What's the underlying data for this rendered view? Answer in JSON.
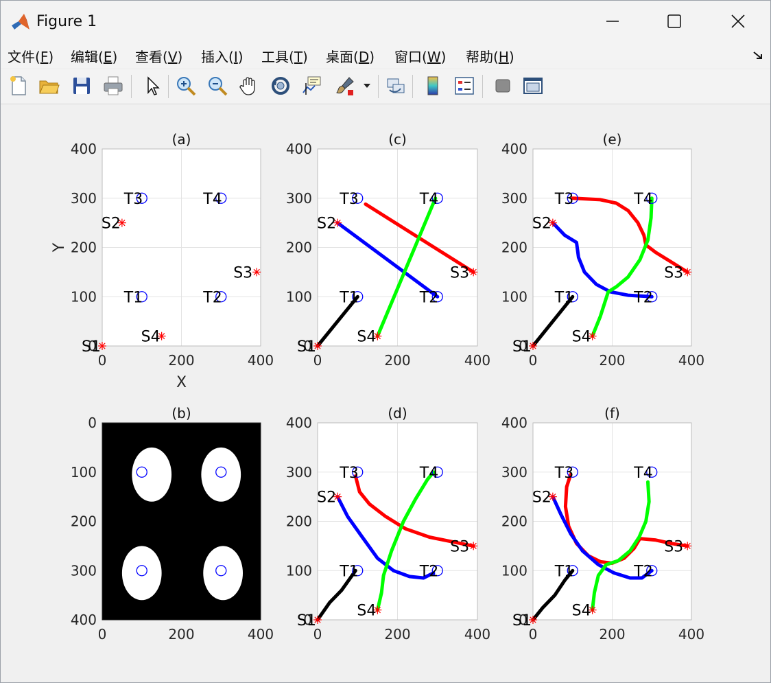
{
  "window": {
    "title": "Figure 1",
    "controls": {
      "minimize": "minimize-icon",
      "maximize": "maximize-icon",
      "close": "close-icon"
    }
  },
  "menu": [
    {
      "label": "文件(",
      "key": "F",
      "end": ")"
    },
    {
      "label": "编辑(",
      "key": "E",
      "end": ")"
    },
    {
      "label": "查看(",
      "key": "V",
      "end": ")"
    },
    {
      "label": "插入(",
      "key": "I",
      "end": ")"
    },
    {
      "label": "工具(",
      "key": "T",
      "end": ")"
    },
    {
      "label": "桌面(",
      "key": "D",
      "end": ")"
    },
    {
      "label": "窗口(",
      "key": "W",
      "end": ")"
    },
    {
      "label": "帮助(",
      "key": "H",
      "end": ")"
    }
  ],
  "toolbar": [
    "new-figure-icon",
    "open-folder-icon",
    "save-icon",
    "print-icon",
    "pointer-icon",
    "zoom-in-icon",
    "zoom-out-icon",
    "pan-icon",
    "rotate-3d-icon",
    "data-cursor-icon",
    "brush-icon",
    "brush-dropdown-icon",
    "link-plot-icon",
    "colorbar-icon",
    "legend-icon",
    "hide-tools-icon",
    "dock-icon"
  ],
  "colors": {
    "red": "#ff0000",
    "blue": "#0000ff",
    "green": "#00ff00",
    "black": "#000000",
    "start_marker": "#ff0000",
    "target_marker": "#0000ff"
  },
  "chart_data": [
    {
      "title": "(a)",
      "type": "scatter",
      "xlabel": "X",
      "ylabel": "Y",
      "xlim": [
        0,
        400
      ],
      "ylim": [
        0,
        400
      ],
      "y_direction": "normal",
      "grid": true,
      "xticks": [
        "0",
        "200",
        "400"
      ],
      "yticks": [
        "400",
        "300",
        "200",
        "100",
        "0"
      ],
      "starts": [
        {
          "label": "S1",
          "x": 0,
          "y": 0
        },
        {
          "label": "S2",
          "x": 50,
          "y": 250
        },
        {
          "label": "S3",
          "x": 390,
          "y": 150
        },
        {
          "label": "S4",
          "x": 150,
          "y": 20
        }
      ],
      "targets": [
        {
          "label": "T1",
          "x": 100,
          "y": 100
        },
        {
          "label": "T2",
          "x": 300,
          "y": 100
        },
        {
          "label": "T3",
          "x": 100,
          "y": 300
        },
        {
          "label": "T4",
          "x": 300,
          "y": 300
        }
      ],
      "paths": []
    },
    {
      "title": "(b)",
      "type": "heatmap",
      "xlabel": "",
      "ylabel": "",
      "xlim": [
        0,
        400
      ],
      "ylim": [
        0,
        400
      ],
      "y_direction": "reverse",
      "grid": false,
      "xticks": [
        "0",
        "200",
        "400"
      ],
      "yticks": [
        "0",
        "100",
        "200",
        "300",
        "400"
      ],
      "ellipses": [
        {
          "cx": 125,
          "cy": 105,
          "rx": 50,
          "ry": 55
        },
        {
          "cx": 300,
          "cy": 105,
          "rx": 50,
          "ry": 55
        },
        {
          "cx": 100,
          "cy": 305,
          "rx": 50,
          "ry": 55
        },
        {
          "cx": 305,
          "cy": 305,
          "rx": 50,
          "ry": 55
        }
      ],
      "targets": [
        {
          "x": 100,
          "y": 100
        },
        {
          "x": 300,
          "y": 100
        },
        {
          "x": 100,
          "y": 300
        },
        {
          "x": 300,
          "y": 300
        }
      ]
    },
    {
      "title": "(c)",
      "type": "line",
      "xlabel": "",
      "ylabel": "",
      "xlim": [
        0,
        400
      ],
      "ylim": [
        0,
        400
      ],
      "y_direction": "normal",
      "grid": true,
      "xticks": [
        "0",
        "200",
        "400"
      ],
      "yticks": [
        "400",
        "300",
        "200",
        "100",
        "0"
      ],
      "starts": [
        {
          "label": "S1",
          "x": 0,
          "y": 0
        },
        {
          "label": "S2",
          "x": 50,
          "y": 250
        },
        {
          "label": "S3",
          "x": 390,
          "y": 150
        },
        {
          "label": "S4",
          "x": 150,
          "y": 20
        }
      ],
      "targets": [
        {
          "label": "T1",
          "x": 100,
          "y": 100
        },
        {
          "label": "T2",
          "x": 300,
          "y": 100
        },
        {
          "label": "T3",
          "x": 100,
          "y": 300
        },
        {
          "label": "T4",
          "x": 300,
          "y": 300
        }
      ],
      "paths": [
        {
          "color": "#ff0000",
          "points": [
            [
              120,
              288
            ],
            [
              390,
              150
            ]
          ]
        },
        {
          "color": "#0000ff",
          "points": [
            [
              50,
              250
            ],
            [
              300,
              100
            ]
          ]
        },
        {
          "color": "#00ff00",
          "points": [
            [
              150,
              20
            ],
            [
              295,
              300
            ]
          ]
        },
        {
          "color": "#000000",
          "points": [
            [
              0,
              0
            ],
            [
              100,
              100
            ]
          ]
        }
      ]
    },
    {
      "title": "(d)",
      "type": "line",
      "xlabel": "",
      "ylabel": "",
      "xlim": [
        0,
        400
      ],
      "ylim": [
        0,
        400
      ],
      "y_direction": "normal",
      "grid": true,
      "xticks": [
        "0",
        "200",
        "400"
      ],
      "yticks": [
        "400",
        "300",
        "200",
        "100",
        "0"
      ],
      "starts": [
        {
          "label": "S1",
          "x": 0,
          "y": 0
        },
        {
          "label": "S2",
          "x": 50,
          "y": 250
        },
        {
          "label": "S3",
          "x": 390,
          "y": 150
        },
        {
          "label": "S4",
          "x": 150,
          "y": 20
        }
      ],
      "targets": [
        {
          "label": "T1",
          "x": 100,
          "y": 100
        },
        {
          "label": "T2",
          "x": 300,
          "y": 100
        },
        {
          "label": "T3",
          "x": 100,
          "y": 300
        },
        {
          "label": "T4",
          "x": 300,
          "y": 300
        }
      ],
      "paths": [
        {
          "color": "#ff0000",
          "points": [
            [
              95,
              292
            ],
            [
              105,
              260
            ],
            [
              130,
              235
            ],
            [
              170,
              210
            ],
            [
              220,
              185
            ],
            [
              280,
              168
            ],
            [
              340,
              158
            ],
            [
              390,
              150
            ]
          ]
        },
        {
          "color": "#0000ff",
          "points": [
            [
              50,
              250
            ],
            [
              75,
              210
            ],
            [
              110,
              170
            ],
            [
              150,
              125
            ],
            [
              190,
              100
            ],
            [
              230,
              88
            ],
            [
              265,
              85
            ],
            [
              290,
              95
            ]
          ]
        },
        {
          "color": "#00ff00",
          "points": [
            [
              150,
              20
            ],
            [
              160,
              55
            ],
            [
              165,
              90
            ],
            [
              185,
              140
            ],
            [
              215,
              200
            ],
            [
              245,
              245
            ],
            [
              275,
              285
            ],
            [
              290,
              300
            ]
          ]
        },
        {
          "color": "#000000",
          "points": [
            [
              0,
              0
            ],
            [
              30,
              35
            ],
            [
              60,
              60
            ],
            [
              95,
              100
            ]
          ]
        }
      ]
    },
    {
      "title": "(e)",
      "type": "line",
      "xlabel": "",
      "ylabel": "",
      "xlim": [
        0,
        400
      ],
      "ylim": [
        0,
        400
      ],
      "y_direction": "normal",
      "grid": true,
      "xticks": [
        "0",
        "200",
        "400"
      ],
      "yticks": [
        "400",
        "300",
        "200",
        "100",
        "0"
      ],
      "starts": [
        {
          "label": "S1",
          "x": 0,
          "y": 0
        },
        {
          "label": "S2",
          "x": 50,
          "y": 250
        },
        {
          "label": "S3",
          "x": 390,
          "y": 150
        },
        {
          "label": "S4",
          "x": 150,
          "y": 20
        }
      ],
      "targets": [
        {
          "label": "T1",
          "x": 100,
          "y": 100
        },
        {
          "label": "T2",
          "x": 300,
          "y": 100
        },
        {
          "label": "T3",
          "x": 100,
          "y": 300
        },
        {
          "label": "T4",
          "x": 300,
          "y": 300
        }
      ],
      "paths": [
        {
          "color": "#ff0000",
          "points": [
            [
              100,
              300
            ],
            [
              170,
              297
            ],
            [
              210,
              290
            ],
            [
              240,
              275
            ],
            [
              265,
              250
            ],
            [
              280,
              225
            ],
            [
              285,
              205
            ],
            [
              310,
              190
            ],
            [
              350,
              170
            ],
            [
              390,
              150
            ]
          ]
        },
        {
          "color": "#0000ff",
          "points": [
            [
              50,
              250
            ],
            [
              80,
              225
            ],
            [
              110,
              210
            ],
            [
              115,
              180
            ],
            [
              130,
              150
            ],
            [
              160,
              125
            ],
            [
              195,
              110
            ],
            [
              240,
              103
            ],
            [
              300,
              100
            ]
          ]
        },
        {
          "color": "#00ff00",
          "points": [
            [
              150,
              20
            ],
            [
              170,
              60
            ],
            [
              190,
              110
            ],
            [
              210,
              120
            ],
            [
              240,
              140
            ],
            [
              270,
              175
            ],
            [
              290,
              215
            ],
            [
              298,
              260
            ],
            [
              300,
              300
            ]
          ]
        },
        {
          "color": "#000000",
          "points": [
            [
              0,
              0
            ],
            [
              100,
              100
            ]
          ]
        }
      ]
    },
    {
      "title": "(f)",
      "type": "line",
      "xlabel": "",
      "ylabel": "",
      "xlim": [
        0,
        400
      ],
      "ylim": [
        0,
        400
      ],
      "y_direction": "normal",
      "grid": true,
      "xticks": [
        "0",
        "200",
        "400"
      ],
      "yticks": [
        "400",
        "300",
        "200",
        "100",
        "0"
      ],
      "starts": [
        {
          "label": "S1",
          "x": 0,
          "y": 0
        },
        {
          "label": "S2",
          "x": 50,
          "y": 250
        },
        {
          "label": "S3",
          "x": 390,
          "y": 150
        },
        {
          "label": "S4",
          "x": 150,
          "y": 20
        }
      ],
      "targets": [
        {
          "label": "T1",
          "x": 100,
          "y": 100
        },
        {
          "label": "T2",
          "x": 300,
          "y": 100
        },
        {
          "label": "T3",
          "x": 100,
          "y": 300
        },
        {
          "label": "T4",
          "x": 300,
          "y": 300
        }
      ],
      "paths": [
        {
          "color": "#ff0000",
          "points": [
            [
              95,
              295
            ],
            [
              85,
              270
            ],
            [
              82,
              230
            ],
            [
              90,
              190
            ],
            [
              110,
              155
            ],
            [
              140,
              130
            ],
            [
              170,
              118
            ],
            [
              200,
              115
            ],
            [
              230,
              125
            ],
            [
              255,
              145
            ],
            [
              270,
              165
            ],
            [
              310,
              162
            ],
            [
              350,
              155
            ],
            [
              390,
              150
            ]
          ]
        },
        {
          "color": "#0000ff",
          "points": [
            [
              50,
              250
            ],
            [
              70,
              215
            ],
            [
              95,
              175
            ],
            [
              125,
              140
            ],
            [
              165,
              112
            ],
            [
              205,
              95
            ],
            [
              245,
              85
            ],
            [
              275,
              85
            ],
            [
              300,
              100
            ]
          ]
        },
        {
          "color": "#00ff00",
          "points": [
            [
              150,
              20
            ],
            [
              155,
              55
            ],
            [
              165,
              90
            ],
            [
              185,
              112
            ],
            [
              215,
              120
            ],
            [
              245,
              140
            ],
            [
              268,
              168
            ],
            [
              285,
              200
            ],
            [
              293,
              240
            ],
            [
              290,
              280
            ]
          ]
        },
        {
          "color": "#000000",
          "points": [
            [
              0,
              0
            ],
            [
              25,
              25
            ],
            [
              55,
              50
            ],
            [
              80,
              80
            ],
            [
              100,
              100
            ]
          ]
        }
      ]
    }
  ]
}
